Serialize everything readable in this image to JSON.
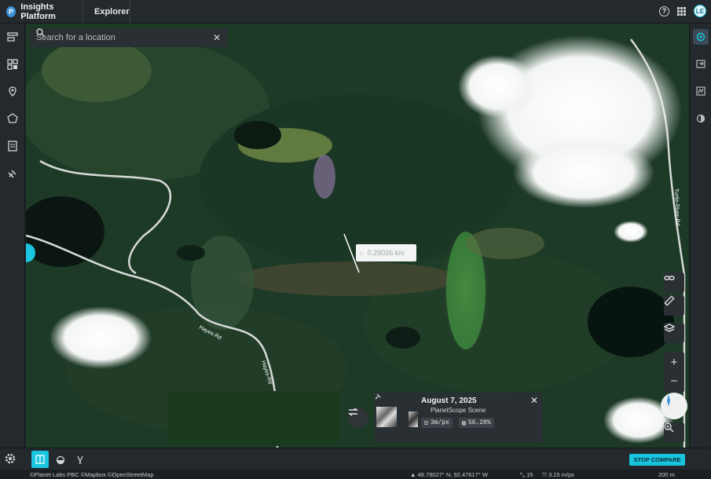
{
  "header": {
    "brand_logo": "P",
    "brand_name": "Insights Platform",
    "nav_tab": "Explorer",
    "avatar_initials": "LE"
  },
  "search": {
    "placeholder": "Search for a location"
  },
  "map": {
    "road_labels": [
      "Hayes-Rd",
      "Hayes-Rd",
      "Turtle-River-Rd"
    ]
  },
  "measure": {
    "value": "0.29026 km"
  },
  "scene": {
    "date": "August 7, 2025",
    "type": "PlanetScope Scene",
    "resolution": "3m/px",
    "cloud": "56.28%"
  },
  "actions": {
    "stop_compare": "STOP COMPARE"
  },
  "status": {
    "attribution": "©Planet Labs PBC ©Mapbox ©OpenStreetMap",
    "coordinates": "48.79027° N, 92.47617° W",
    "zoom": "15",
    "resolution": "3.15 m/px",
    "scale": "200 m"
  },
  "colors": {
    "accent": "#1cc6e0",
    "chrome": "#24292e",
    "forest": "#1c3a28"
  }
}
